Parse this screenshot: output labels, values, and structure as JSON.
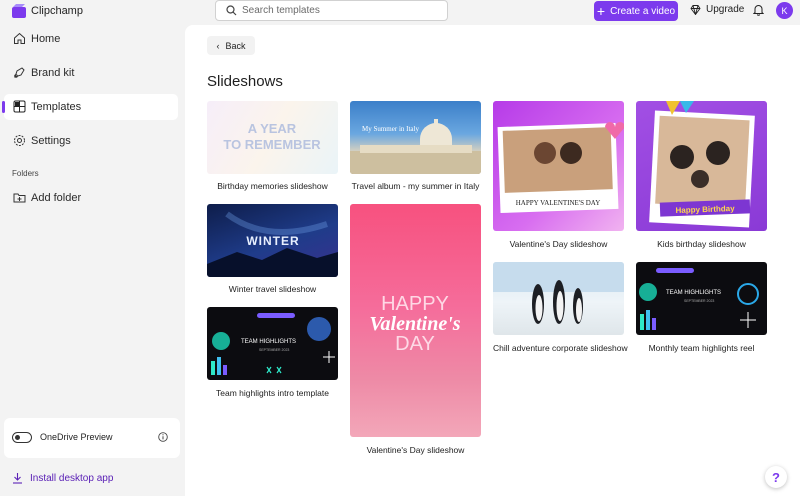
{
  "app": {
    "title": "Clipchamp"
  },
  "search": {
    "placeholder": "Search templates"
  },
  "header": {
    "create_label": "Create a video",
    "upgrade_label": "Upgrade",
    "avatar_initial": "K"
  },
  "sidebar": {
    "items": [
      {
        "label": "Home",
        "icon": "home-icon"
      },
      {
        "label": "Brand kit",
        "icon": "brand-kit-icon"
      },
      {
        "label": "Templates",
        "icon": "templates-icon",
        "active": true
      },
      {
        "label": "Settings",
        "icon": "gear-icon"
      }
    ],
    "folders_heading": "Folders",
    "add_folder_label": "Add folder",
    "onedrive_label": "OneDrive Preview",
    "install_label": "Install desktop app"
  },
  "main": {
    "back_label": "Back",
    "section_title": "Slideshows",
    "templates": [
      {
        "caption": "Birthday memories slideshow",
        "thumb_text": [
          "A YEAR",
          "TO REMEMBER"
        ]
      },
      {
        "caption": "Travel album - my summer in Italy",
        "thumb_text": [
          "My Summer in Italy"
        ]
      },
      {
        "caption": "Valentine's Day slideshow",
        "thumb_text": [
          "HAPPY VALENTINE'S DAY"
        ]
      },
      {
        "caption": "Kids birthday slideshow",
        "thumb_text": [
          "Happy Birthday"
        ]
      },
      {
        "caption": "Winter travel slideshow",
        "thumb_text": [
          "WINTER"
        ]
      },
      {
        "caption": "Valentine's Day slideshow",
        "thumb_text": [
          "HAPPY",
          "Valentine's",
          "DAY"
        ]
      },
      {
        "caption": "Chill adventure corporate slideshow",
        "thumb_text": []
      },
      {
        "caption": "Monthly team highlights reel",
        "thumb_text": [
          "TEAM HIGHLIGHTS",
          "SEPTEMBER 2023"
        ]
      },
      {
        "caption": "Team highlights intro template",
        "thumb_text": [
          "TEAM HIGHLIGHTS",
          "SEPTEMBER 2023"
        ]
      }
    ]
  },
  "help": {
    "label": "?"
  },
  "colors": {
    "accent": "#7c3aed",
    "background": "#f3f3f3"
  }
}
